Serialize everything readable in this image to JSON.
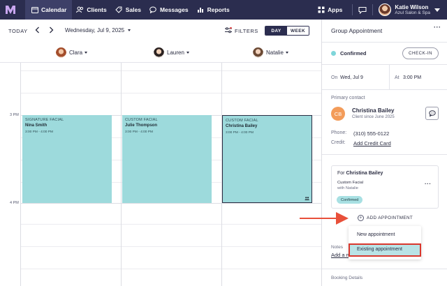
{
  "nav": {
    "items": [
      {
        "label": "Calendar",
        "icon": "calendar-icon",
        "active": true
      },
      {
        "label": "Clients",
        "icon": "clients-icon"
      },
      {
        "label": "Sales",
        "icon": "tag-icon"
      },
      {
        "label": "Messages",
        "icon": "chat-icon"
      },
      {
        "label": "Reports",
        "icon": "bar-chart-icon"
      }
    ],
    "apps_label": "Apps",
    "user_name": "Katie Wilson",
    "user_business": "Azul Salon & Spa"
  },
  "toolbar": {
    "today_label": "TODAY",
    "date_label": "Wednesday, Jul 9, 2025",
    "filters_label": "FILTERS",
    "day_label": "DAY",
    "week_label": "WEEK"
  },
  "staff": [
    {
      "name": "Clara"
    },
    {
      "name": "Lauren"
    },
    {
      "name": "Natalie"
    }
  ],
  "time_labels": {
    "t3": "3 PM",
    "t4": "4 PM"
  },
  "appointments": [
    {
      "service": "SIGNATURE FACIAL",
      "client": "Nina Smith",
      "time": "3:00 PM - 4:00 PM"
    },
    {
      "service": "CUSTOM FACIAL",
      "client": "Julie Thompson",
      "time": "3:00 PM - 4:00 PM"
    },
    {
      "service": "CUSTOM FACIAL",
      "client": "Christina Bailey",
      "time": "3:00 PM - 4:00 PM",
      "selected": true
    }
  ],
  "panel": {
    "title": "Group Appointment",
    "status": "Confirmed",
    "checkin_label": "CHECK-IN",
    "on_label": "On",
    "on_value": "Wed, Jul 9",
    "at_label": "At",
    "at_value": "3:00 PM",
    "primary_contact_label": "Primary contact",
    "contact_initials": "CB",
    "contact_name": "Christina Bailey",
    "contact_since": "Client since June 2025",
    "phone_label": "Phone:",
    "phone_value": "(310) 555-0122",
    "credit_label": "Credit:",
    "credit_value": "Add Credit Card",
    "card_for_prefix": "For",
    "card_for_name": "Christina Bailey",
    "card_service": "Custom Facial",
    "card_with": "with Natalie",
    "card_badge": "Confirmed",
    "add_appt_label": "ADD APPOINTMENT",
    "dropdown_new": "New appointment",
    "dropdown_existing": "Existing appointment",
    "notes_label": "Notes",
    "add_note_label": "Add a n",
    "booking_label": "Booking Details"
  },
  "colors": {
    "nav_bg": "#2b2d4f",
    "appointment_fill": "#9ddadc",
    "highlight_border": "#d9372d",
    "annotation_arrow": "#e8503a",
    "avatar_bg": "#f39c5a"
  }
}
